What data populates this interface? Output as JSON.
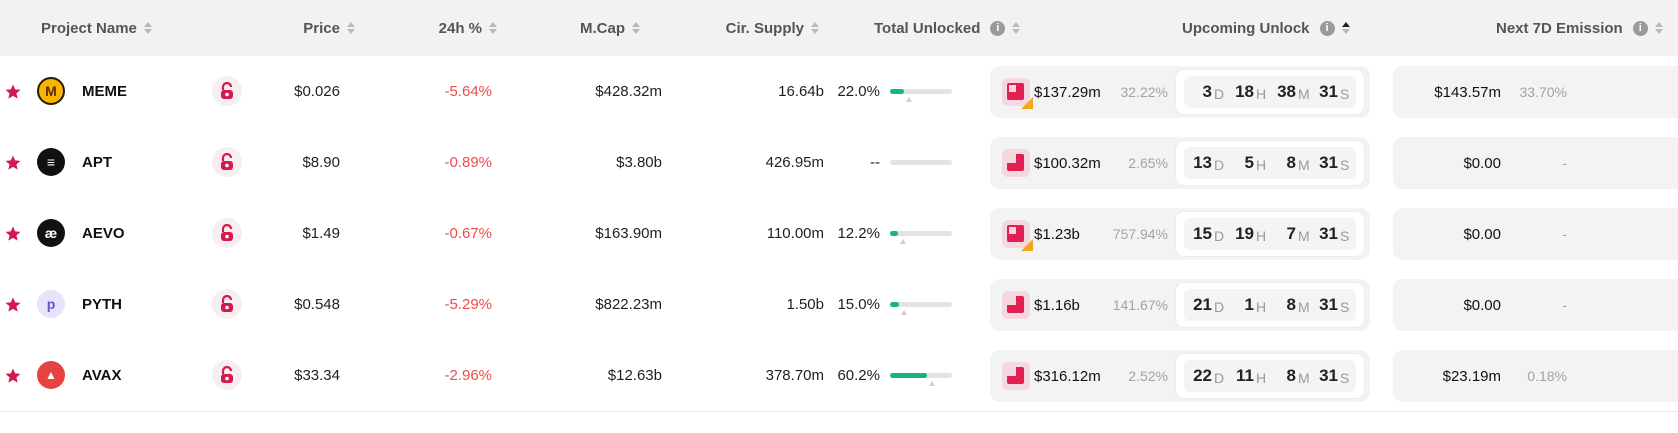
{
  "columns": {
    "project_name": "Project Name",
    "price": "Price",
    "change_24h": "24h %",
    "mcap": "M.Cap",
    "cir_supply": "Cir. Supply",
    "total_unlocked": "Total Unlocked",
    "upcoming_unlock": "Upcoming Unlock",
    "next_7d_emission": "Next 7D Emission"
  },
  "colors": {
    "accent": "#e01f53",
    "negative": "#ef4b4b",
    "progress": "#16b47e",
    "header_bg": "#f2f2f2"
  },
  "timer_units": {
    "d": "D",
    "h": "H",
    "m": "M",
    "s": "S"
  },
  "rows": [
    {
      "name": "MEME",
      "logo_icon": "meme-logo-icon",
      "logo_glyph": "M",
      "price": "$0.026",
      "change": "-5.64%",
      "mcap": "$428.32m",
      "supply": "16.64b",
      "unlocked": "22.0%",
      "unlocked_fraction": 0.22,
      "unlock_amount": "$137.29m",
      "unlock_pct": "32.22%",
      "unlock_type_multi": true,
      "days": "3",
      "hours": "18",
      "minutes": "38",
      "seconds": "31",
      "emission": "$143.57m",
      "emission_pct": "33.70%"
    },
    {
      "name": "APT",
      "logo_icon": "aptos-logo-icon",
      "logo_glyph": "≡",
      "price": "$8.90",
      "change": "-0.89%",
      "mcap": "$3.80b",
      "supply": "426.95m",
      "unlocked": "--",
      "unlocked_fraction": 0,
      "unlock_amount": "$100.32m",
      "unlock_pct": "2.65%",
      "unlock_type_multi": false,
      "days": "13",
      "hours": "5",
      "minutes": "8",
      "seconds": "31",
      "emission": "$0.00",
      "emission_pct": "-"
    },
    {
      "name": "AEVO",
      "logo_icon": "aevo-logo-icon",
      "logo_glyph": "æ",
      "price": "$1.49",
      "change": "-0.67%",
      "mcap": "$163.90m",
      "supply": "110.00m",
      "unlocked": "12.2%",
      "unlocked_fraction": 0.122,
      "unlock_amount": "$1.23b",
      "unlock_pct": "757.94%",
      "unlock_type_multi": true,
      "days": "15",
      "hours": "19",
      "minutes": "7",
      "seconds": "31",
      "emission": "$0.00",
      "emission_pct": "-"
    },
    {
      "name": "PYTH",
      "logo_icon": "pyth-logo-icon",
      "logo_glyph": "p",
      "price": "$0.548",
      "change": "-5.29%",
      "mcap": "$822.23m",
      "supply": "1.50b",
      "unlocked": "15.0%",
      "unlocked_fraction": 0.15,
      "unlock_amount": "$1.16b",
      "unlock_pct": "141.67%",
      "unlock_type_multi": false,
      "days": "21",
      "hours": "1",
      "minutes": "8",
      "seconds": "31",
      "emission": "$0.00",
      "emission_pct": "-"
    },
    {
      "name": "AVAX",
      "logo_icon": "avalanche-logo-icon",
      "logo_glyph": "▲",
      "price": "$33.34",
      "change": "-2.96%",
      "mcap": "$12.63b",
      "supply": "378.70m",
      "unlocked": "60.2%",
      "unlocked_fraction": 0.602,
      "unlock_amount": "$316.12m",
      "unlock_pct": "2.52%",
      "unlock_type_multi": false,
      "days": "22",
      "hours": "11",
      "minutes": "8",
      "seconds": "31",
      "emission": "$23.19m",
      "emission_pct": "0.18%"
    }
  ]
}
